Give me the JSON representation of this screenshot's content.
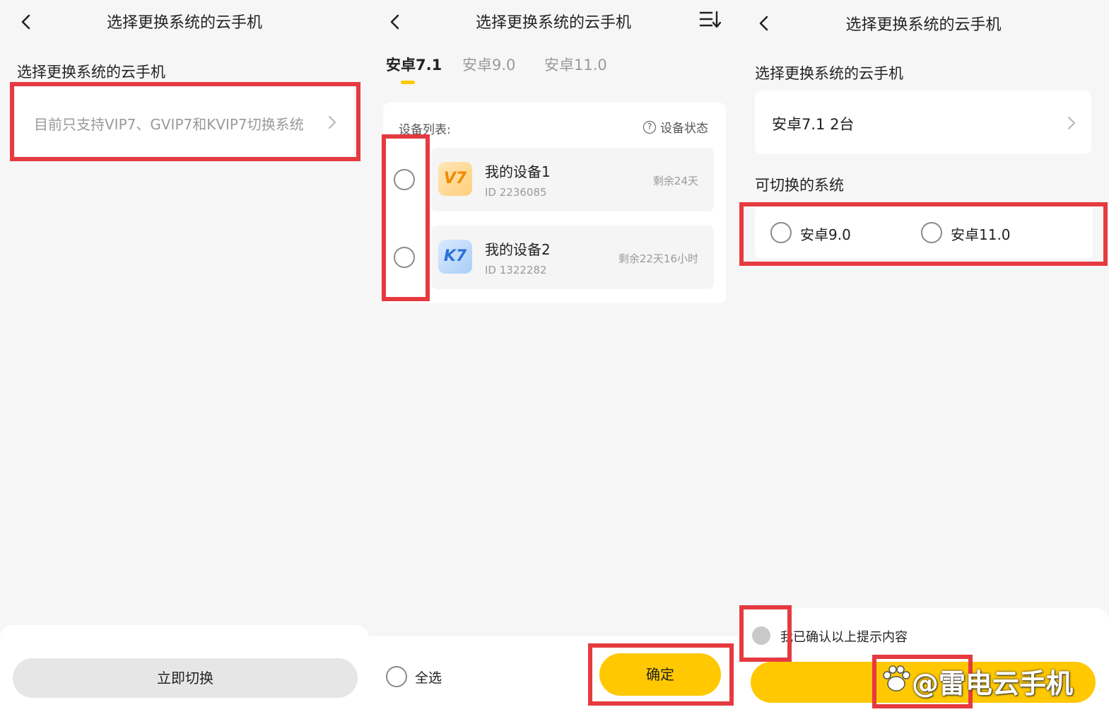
{
  "panel1": {
    "title": "选择更换系统的云手机",
    "section_label": "选择更换系统的云手机",
    "notice_text": "目前只支持VIP7、GVIP7和KVIP7切换系统",
    "switch_button": "立即切换"
  },
  "panel2": {
    "title": "选择更换系统的云手机",
    "tabs": [
      {
        "label": "安卓7.1",
        "active": true
      },
      {
        "label": "安卓9.0",
        "active": false
      },
      {
        "label": "安卓11.0",
        "active": false
      }
    ],
    "device_list_label": "设备列表:",
    "device_status_label": "设备状态",
    "devices": [
      {
        "badge": "V7",
        "name": "我的设备1",
        "id": "ID 2236085",
        "remaining": "剩余24天"
      },
      {
        "badge": "K7",
        "name": "我的设备2",
        "id": "ID 1322282",
        "remaining": "剩余22天16小时"
      }
    ],
    "select_all": "全选",
    "confirm_button": "确定"
  },
  "panel3": {
    "title": "选择更换系统的云手机",
    "section_label": "选择更换系统的云手机",
    "selected_devices": "安卓7.1 2台",
    "switchable_label": "可切换的系统",
    "systems": [
      "安卓9.0",
      "安卓11.0"
    ],
    "confirm_text": "我已确认以上提示内容",
    "watermark": "@雷电云手机"
  },
  "colors": {
    "accent_yellow": "#ffc800",
    "highlight_red": "#e53a40",
    "background": "#f6f6f6"
  }
}
